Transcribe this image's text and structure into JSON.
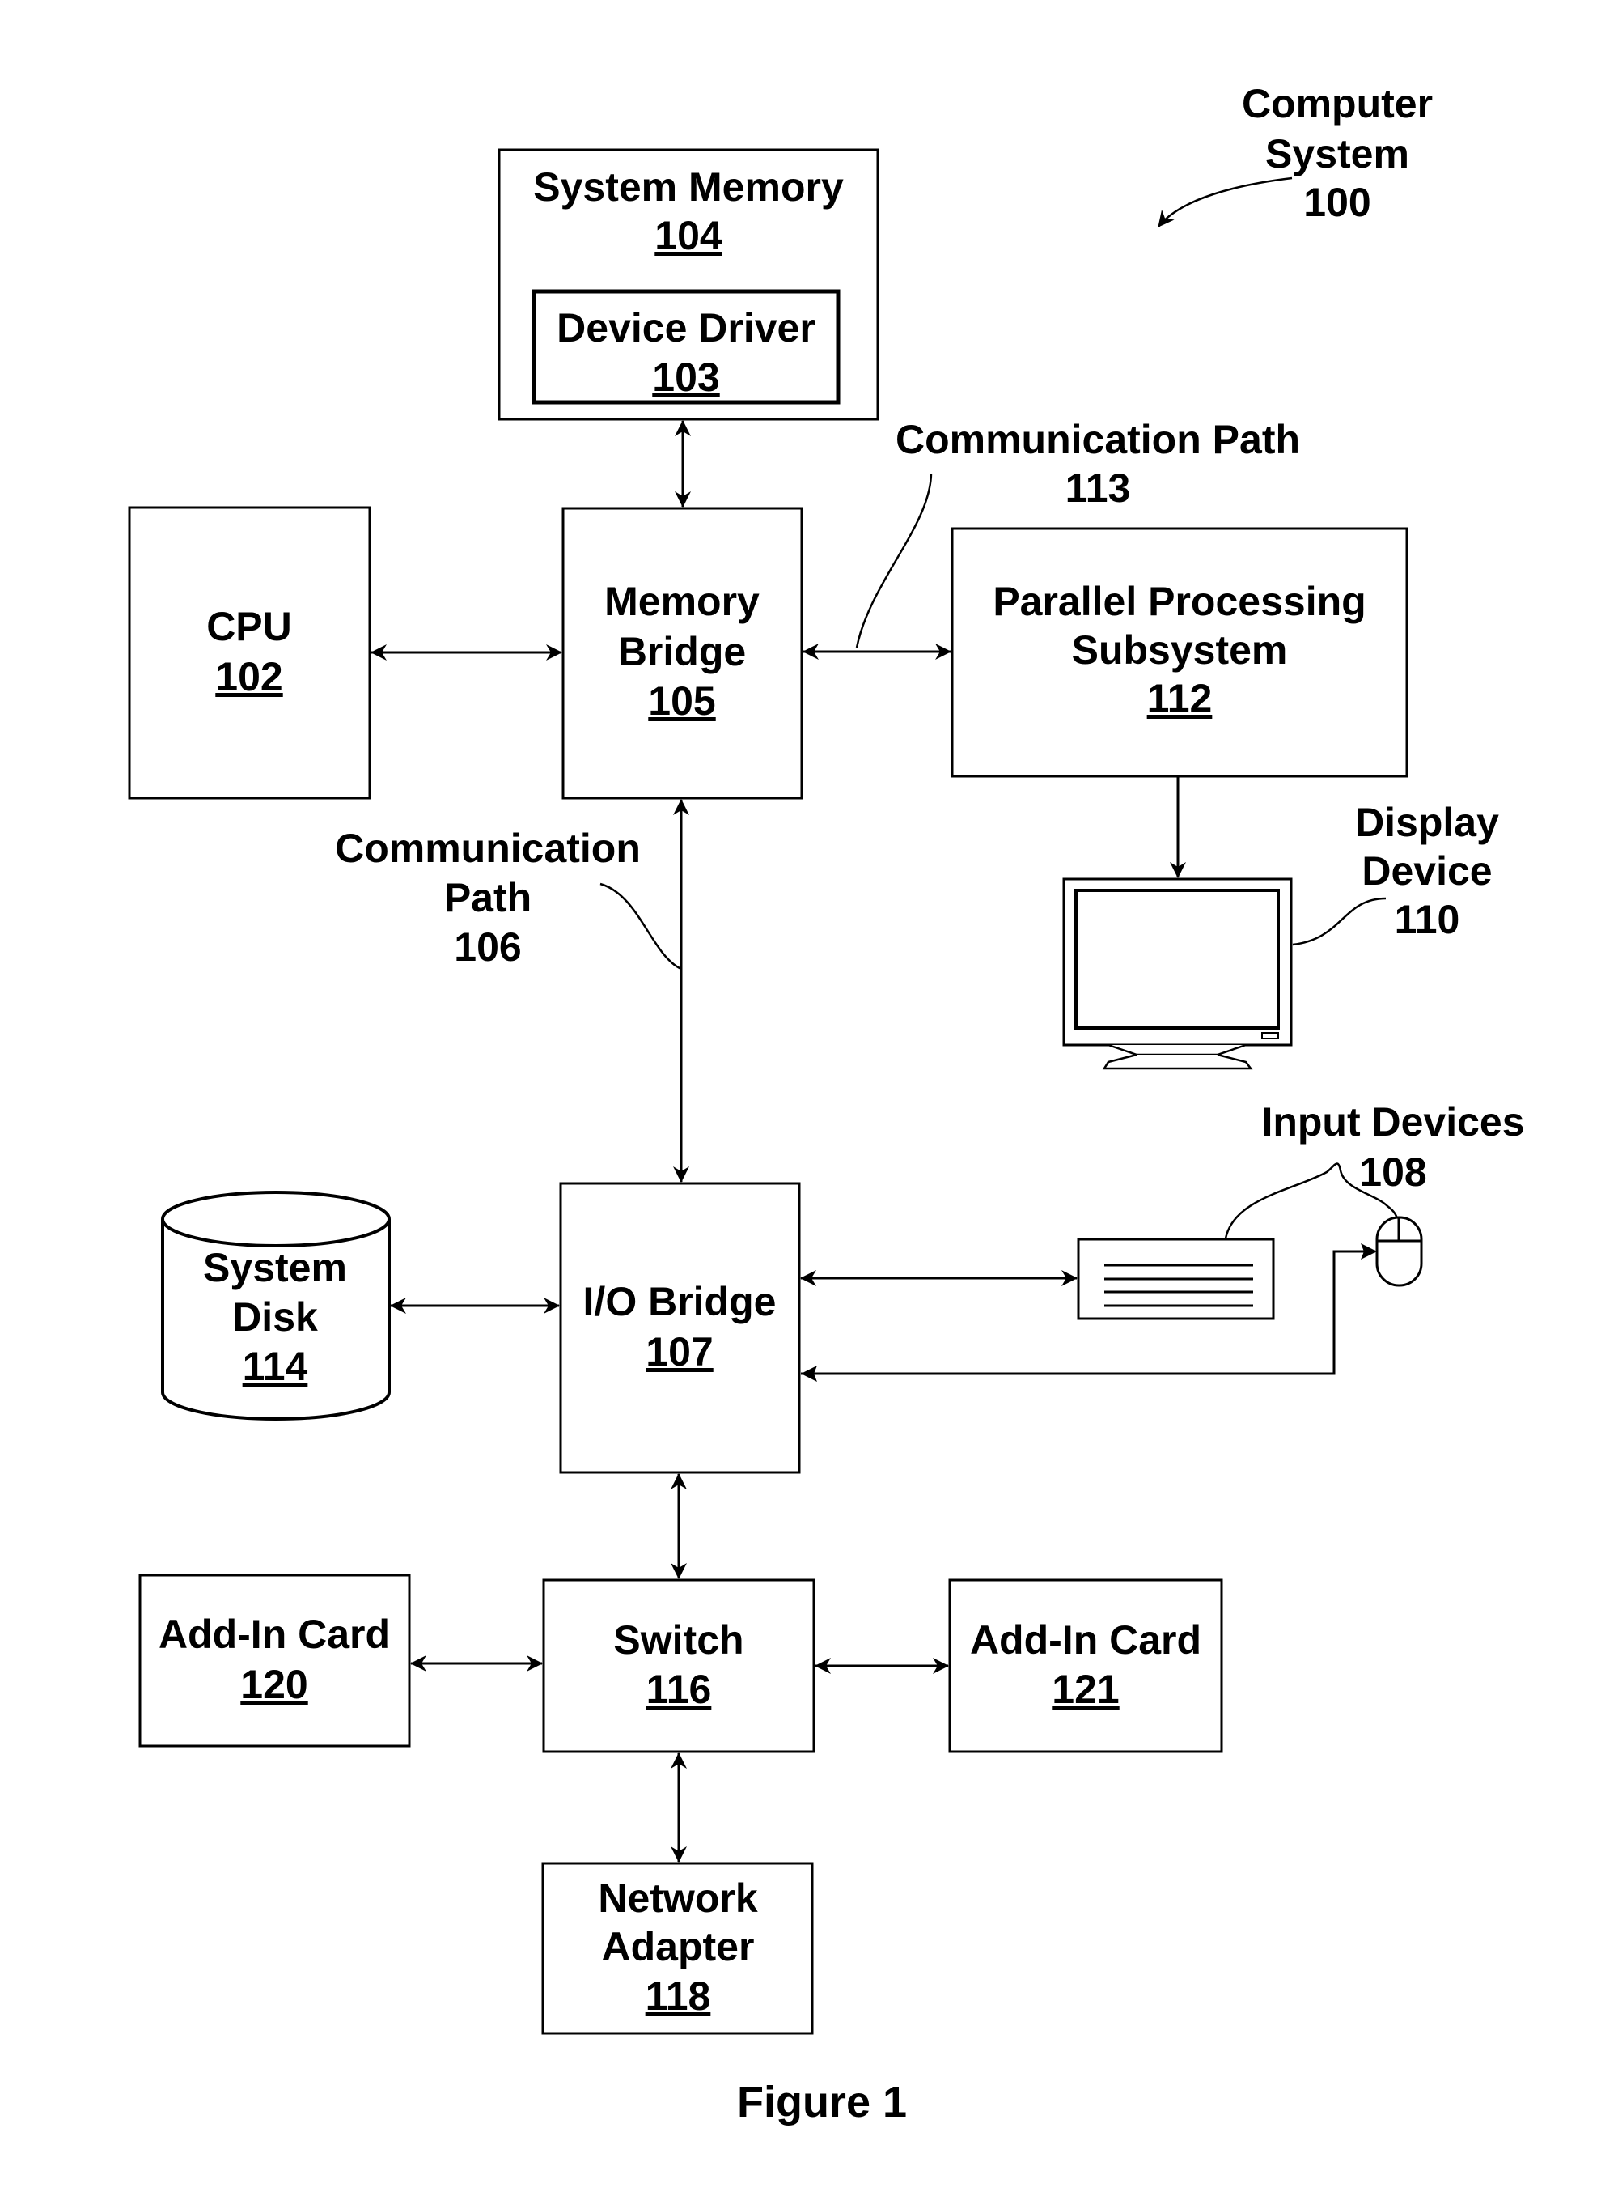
{
  "figure": {
    "caption": "Figure 1",
    "system_label": {
      "lines": [
        "Computer",
        "System",
        "100"
      ]
    }
  },
  "blocks": {
    "system_memory": {
      "name": "System Memory",
      "ref": "104"
    },
    "device_driver": {
      "name": "Device Driver",
      "ref": "103"
    },
    "cpu": {
      "name": "CPU",
      "ref": "102"
    },
    "memory_bridge": {
      "lines": [
        "Memory",
        "Bridge"
      ],
      "ref": "105"
    },
    "parallel_processing": {
      "lines": [
        "Parallel Processing",
        "Subsystem"
      ],
      "ref": "112"
    },
    "io_bridge": {
      "name": "I/O Bridge",
      "ref": "107"
    },
    "system_disk": {
      "lines": [
        "System",
        "Disk"
      ],
      "ref": "114"
    },
    "switch": {
      "name": "Switch",
      "ref": "116"
    },
    "add_in_card_120": {
      "name": "Add-In Card",
      "ref": "120"
    },
    "add_in_card_121": {
      "name": "Add-In Card",
      "ref": "121"
    },
    "network_adapter": {
      "lines": [
        "Network",
        "Adapter"
      ],
      "ref": "118"
    }
  },
  "callouts": {
    "comm_path_113": {
      "lines": [
        "Communication Path",
        "113"
      ]
    },
    "comm_path_106": {
      "lines": [
        "Communication",
        "Path",
        "106"
      ]
    },
    "display_device": {
      "lines": [
        "Display",
        "Device",
        "110"
      ]
    },
    "input_devices": {
      "lines": [
        "Input Devices",
        "108"
      ]
    }
  },
  "icons": {
    "display": "monitor-icon",
    "keyboard": "keyboard-icon",
    "mouse": "mouse-icon",
    "disk": "disk-cylinder-icon"
  }
}
